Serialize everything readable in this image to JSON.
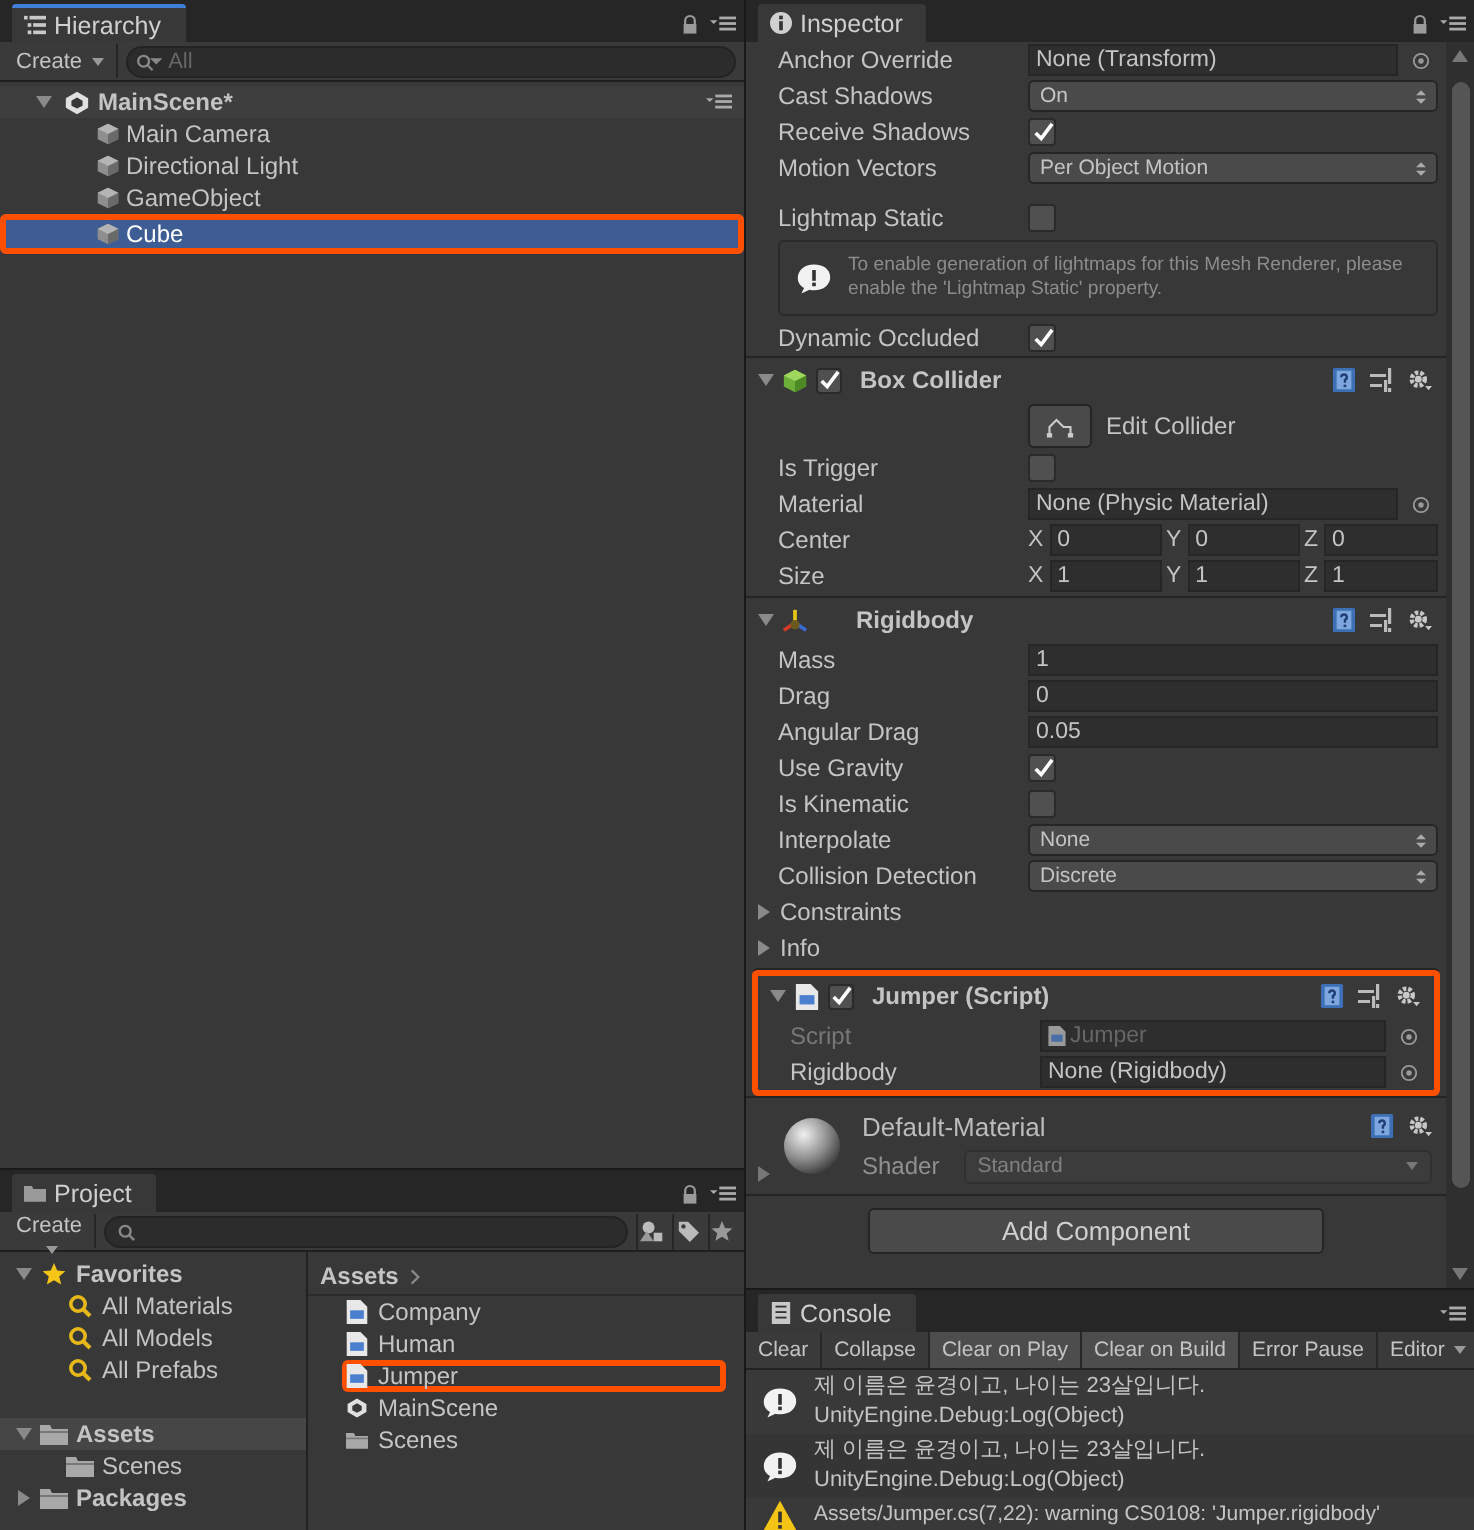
{
  "hierarchy": {
    "tab": "Hierarchy",
    "create": "Create",
    "search_placeholder": "All",
    "scene": {
      "name": "MainScene*",
      "expanded": true
    },
    "objects": [
      {
        "name": "Main Camera",
        "selected": false,
        "highlighted": false
      },
      {
        "name": "Directional Light",
        "selected": false,
        "highlighted": false
      },
      {
        "name": "GameObject",
        "selected": false,
        "highlighted": false
      },
      {
        "name": "Cube",
        "selected": true,
        "highlighted": true
      }
    ]
  },
  "inspector": {
    "tab": "Inspector",
    "renderer": {
      "fields": [
        {
          "kind": "object",
          "label": "Anchor Override",
          "value": "None (Transform)"
        },
        {
          "kind": "dropdown",
          "label": "Cast Shadows",
          "value": "On"
        },
        {
          "kind": "checkbox",
          "label": "Receive Shadows",
          "checked": true
        },
        {
          "kind": "dropdown",
          "label": "Motion Vectors",
          "value": "Per Object Motion"
        }
      ],
      "lightmap_static": {
        "label": "Lightmap Static",
        "checked": false
      },
      "help": "To enable generation of lightmaps for this Mesh Renderer, please enable the 'Lightmap Static' property.",
      "dynamic_occluded": {
        "label": "Dynamic Occluded",
        "checked": true
      }
    },
    "components": [
      {
        "kind": "box_collider",
        "title": "Box Collider",
        "enabled": true,
        "expanded": true,
        "highlighted": false,
        "edit_button": "Edit Collider",
        "fields": [
          {
            "kind": "checkbox",
            "label": "Is Trigger",
            "checked": false
          },
          {
            "kind": "object",
            "label": "Material",
            "value": "None (Physic Material)"
          },
          {
            "kind": "vector3",
            "label": "Center",
            "values": [
              {
                "axis": "X",
                "value": "0"
              },
              {
                "axis": "Y",
                "value": "0"
              },
              {
                "axis": "Z",
                "value": "0"
              }
            ]
          },
          {
            "kind": "vector3",
            "label": "Size",
            "values": [
              {
                "axis": "X",
                "value": "1"
              },
              {
                "axis": "Y",
                "value": "1"
              },
              {
                "axis": "Z",
                "value": "1"
              }
            ]
          }
        ]
      },
      {
        "kind": "rigidbody",
        "title": "Rigidbody",
        "expanded": true,
        "highlighted": false,
        "fields": [
          {
            "kind": "number",
            "label": "Mass",
            "value": "1"
          },
          {
            "kind": "number",
            "label": "Drag",
            "value": "0"
          },
          {
            "kind": "number",
            "label": "Angular Drag",
            "value": "0.05"
          },
          {
            "kind": "checkbox",
            "label": "Use Gravity",
            "checked": true
          },
          {
            "kind": "checkbox",
            "label": "Is Kinematic",
            "checked": false
          },
          {
            "kind": "dropdown",
            "label": "Interpolate",
            "value": "None"
          },
          {
            "kind": "dropdown",
            "label": "Collision Detection",
            "value": "Discrete"
          }
        ],
        "foldouts": [
          {
            "label": "Constraints",
            "expanded": false
          },
          {
            "label": "Info",
            "expanded": false
          }
        ]
      },
      {
        "kind": "script",
        "title": "Jumper (Script)",
        "enabled": true,
        "expanded": true,
        "highlighted": true,
        "fields": [
          {
            "kind": "script_object",
            "label": "Script",
            "value": "Jumper",
            "disabled": true
          },
          {
            "kind": "object",
            "label": "Rigidbody",
            "value": "None (Rigidbody)",
            "disabled": false
          }
        ]
      }
    ],
    "material": {
      "name": "Default-Material",
      "shader_label": "Shader",
      "shader": "Standard",
      "expanded": false
    },
    "add_component": "Add Component"
  },
  "project": {
    "tab": "Project",
    "create": "Create",
    "favorites": {
      "label": "Favorites",
      "expanded": true,
      "items": [
        "All Materials",
        "All Models",
        "All Prefabs"
      ]
    },
    "folders": [
      {
        "name": "Assets",
        "expanded": true,
        "selected": true,
        "children": [
          {
            "name": "Scenes",
            "selected": false
          }
        ]
      },
      {
        "name": "Packages",
        "expanded": false,
        "selected": false
      }
    ],
    "breadcrumb": "Assets",
    "assets": [
      {
        "name": "Company",
        "kind": "script",
        "highlighted": false
      },
      {
        "name": "Human",
        "kind": "script",
        "highlighted": false
      },
      {
        "name": "Jumper",
        "kind": "script",
        "highlighted": true
      },
      {
        "name": "MainScene",
        "kind": "scene",
        "highlighted": false
      },
      {
        "name": "Scenes",
        "kind": "folder",
        "highlighted": false
      }
    ]
  },
  "console": {
    "tab": "Console",
    "buttons": [
      {
        "label": "Clear",
        "selected": false
      },
      {
        "label": "Collapse",
        "selected": false
      },
      {
        "label": "Clear on Play",
        "selected": true
      },
      {
        "label": "Clear on Build",
        "selected": true
      },
      {
        "label": "Error Pause",
        "selected": false
      }
    ],
    "dropdown": "Editor",
    "messages": [
      {
        "kind": "log",
        "lines": [
          "제 이름은 윤경이고, 나이는 23살입니다.",
          "UnityEngine.Debug:Log(Object)"
        ]
      },
      {
        "kind": "log",
        "lines": [
          "제 이름은 윤경이고, 나이는 23살입니다.",
          "UnityEngine.Debug:Log(Object)"
        ]
      },
      {
        "kind": "warning",
        "lines": [
          "Assets/Jumper.cs(7,22): warning CS0108: 'Jumper.rigidbody'"
        ]
      }
    ]
  }
}
